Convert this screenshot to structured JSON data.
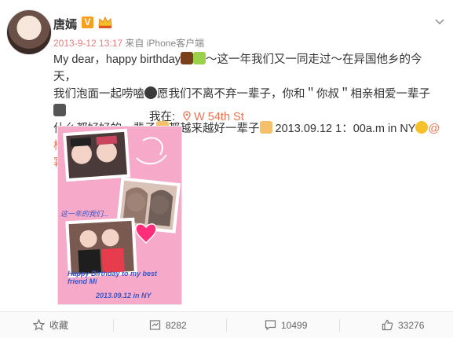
{
  "user": {
    "name": "唐嫣",
    "verified_badge": "V"
  },
  "meta": {
    "time": "2013-9-12 13:17",
    "source": "来自 iPhone客户端"
  },
  "post": {
    "line1": "My dear，happy birthday",
    "line1b": "～这一年我们又一同走过～在异国他乡的今天，",
    "line2a": "我们泡面一起唠嗑",
    "line2b": "愿我们不离不弃一辈子",
    "line2c": "，你和＂你叔＂相亲相爱一辈子",
    "line3a": "什么都好好的一辈子",
    "line3b": "都越来越好一辈子",
    "line3c": " 2013.09.12 1：00a.m in NY",
    "mention": "@杨",
    "mention2": "幂"
  },
  "location": {
    "prefix": "我在:",
    "place": "W 54th St"
  },
  "photo": {
    "caption1": "这一年的我们...",
    "caption2": "Happy Birthday to my best friend Mi",
    "caption3": "2013.09.12  in NY"
  },
  "actions": {
    "favorite": "收藏",
    "repost": "8282",
    "comment": "10499",
    "like": "33276"
  },
  "colors": {
    "accent": "#eb7350",
    "badge": "#f7a01d",
    "photo_bg": "#f6a9c8"
  }
}
